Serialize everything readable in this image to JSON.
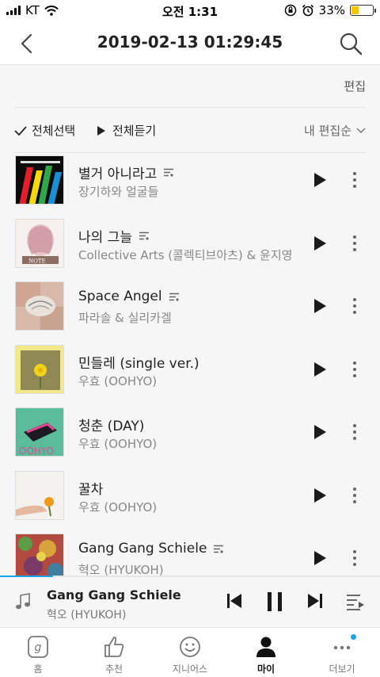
{
  "status": {
    "carrier": "KT",
    "time": "오전 1:31",
    "battery": "33%",
    "battery_level": 0.33,
    "battery_color": "#f2c600"
  },
  "nav": {
    "title": "2019-02-13 01:29:45",
    "back_icon": "chevron-left-icon",
    "search_icon": "search-icon"
  },
  "toolbar": {
    "edit_label": "편집",
    "select_all_label": "전체선택",
    "play_all_label": "전체듣기",
    "sort_label": "내 편집순"
  },
  "tracks": [
    {
      "title": "별거 아니라고",
      "artist": "장기하와 얼굴들",
      "has_lyrics": true
    },
    {
      "title": "나의 그늘",
      "artist": "Collective Arts (콜렉티브아츠) & 윤지영",
      "has_lyrics": true
    },
    {
      "title": "Space Angel",
      "artist": "파라솔 & 실리카겔",
      "has_lyrics": true
    },
    {
      "title": "민들레 (single ver.)",
      "artist": "우효 (OOHYO)",
      "has_lyrics": false
    },
    {
      "title": "청춘 (DAY)",
      "artist": "우효 (OOHYO)",
      "has_lyrics": false
    },
    {
      "title": "꿀차",
      "artist": "우효 (OOHYO)",
      "has_lyrics": false
    },
    {
      "title": "Gang Gang Schiele",
      "artist": "혁오 (HYUKOH)",
      "has_lyrics": true
    }
  ],
  "album_art": [
    {
      "text": ""
    },
    {
      "text": "NOTE"
    },
    {
      "text": ""
    },
    {
      "text": ""
    },
    {
      "text": "OOHYO"
    },
    {
      "text": ""
    },
    {
      "text": ""
    }
  ],
  "now_playing": {
    "title": "Gang Gang Schiele",
    "artist": "혁오 (HYUKOH)",
    "progress": 0.14,
    "accent": "#1aa5e8"
  },
  "tabs": [
    {
      "label": "홈",
      "icon": "home-g-icon"
    },
    {
      "label": "추천",
      "icon": "thumbs-up-icon"
    },
    {
      "label": "지니어스",
      "icon": "smile-icon"
    },
    {
      "label": "마이",
      "icon": "person-icon",
      "active": true
    },
    {
      "label": "더보기",
      "icon": "more-dots-icon",
      "badge": true
    }
  ]
}
